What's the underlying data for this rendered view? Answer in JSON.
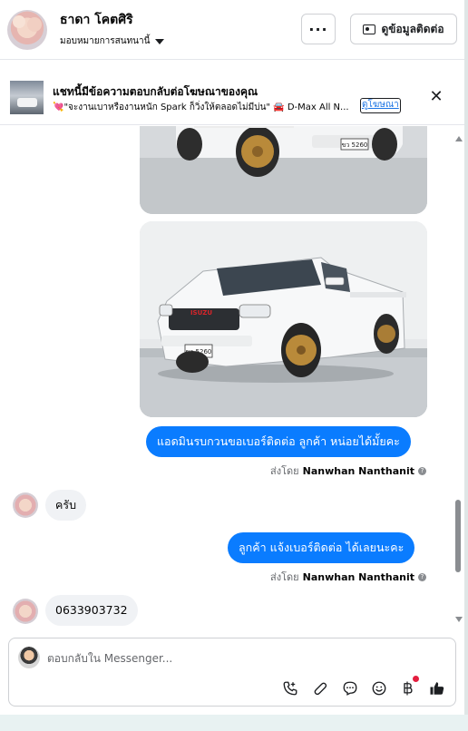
{
  "header": {
    "contact_name": "ธาดา โคตศิริ",
    "assign_label": "มอบหมายการสนทนานี้",
    "more_label": "···",
    "contact_button_label": "ดูข้อมูลติดต่อ"
  },
  "ad_banner": {
    "title": "แชทนี้มีข้อความตอบกลับต่อโฆษณาของคุณ",
    "text": "💘\"จะงานเบาหรืองานหนัก Spark ก็วิ่งให้ตลอดไม่มีบ่น\" 🚘 D-Max All N...",
    "link_label": "ดูโฆษณา",
    "close_label": "✕"
  },
  "messages": [
    {
      "type": "image",
      "direction": "outgoing",
      "plate": "ขว 5260"
    },
    {
      "type": "image",
      "direction": "outgoing",
      "plate": "ขว 5260",
      "badge": "ISUZU"
    },
    {
      "type": "text",
      "direction": "outgoing",
      "text": "แอดมินรบกวนขอเบอร์ติดต่อ ลูกค้า หน่อยได้มั้ยคะ",
      "sent_by_prefix": "ส่งโดย",
      "sent_by_name": "Nanwhan Nanthanit"
    },
    {
      "type": "text",
      "direction": "incoming",
      "text": "ครับ"
    },
    {
      "type": "text",
      "direction": "outgoing",
      "text": "ลูกค้า แจ้งเบอร์ติดต่อ ได้เลยนะคะ",
      "sent_by_prefix": "ส่งโดย",
      "sent_by_name": "Nanwhan Nanthanit"
    },
    {
      "type": "text",
      "direction": "incoming",
      "text": "0633903732"
    }
  ],
  "composer": {
    "placeholder": "ตอบกลับใน Messenger...",
    "tools": [
      "phone-plus-icon",
      "paperclip-icon",
      "saved-reply-icon",
      "emoji-icon",
      "baht-icon",
      "thumbs-up-icon"
    ]
  },
  "colors": {
    "outgoing_bubble": "#0a7cff",
    "incoming_bubble": "#f0f2f5",
    "link": "#1b74e4",
    "notification_dot": "#e41e3f"
  }
}
